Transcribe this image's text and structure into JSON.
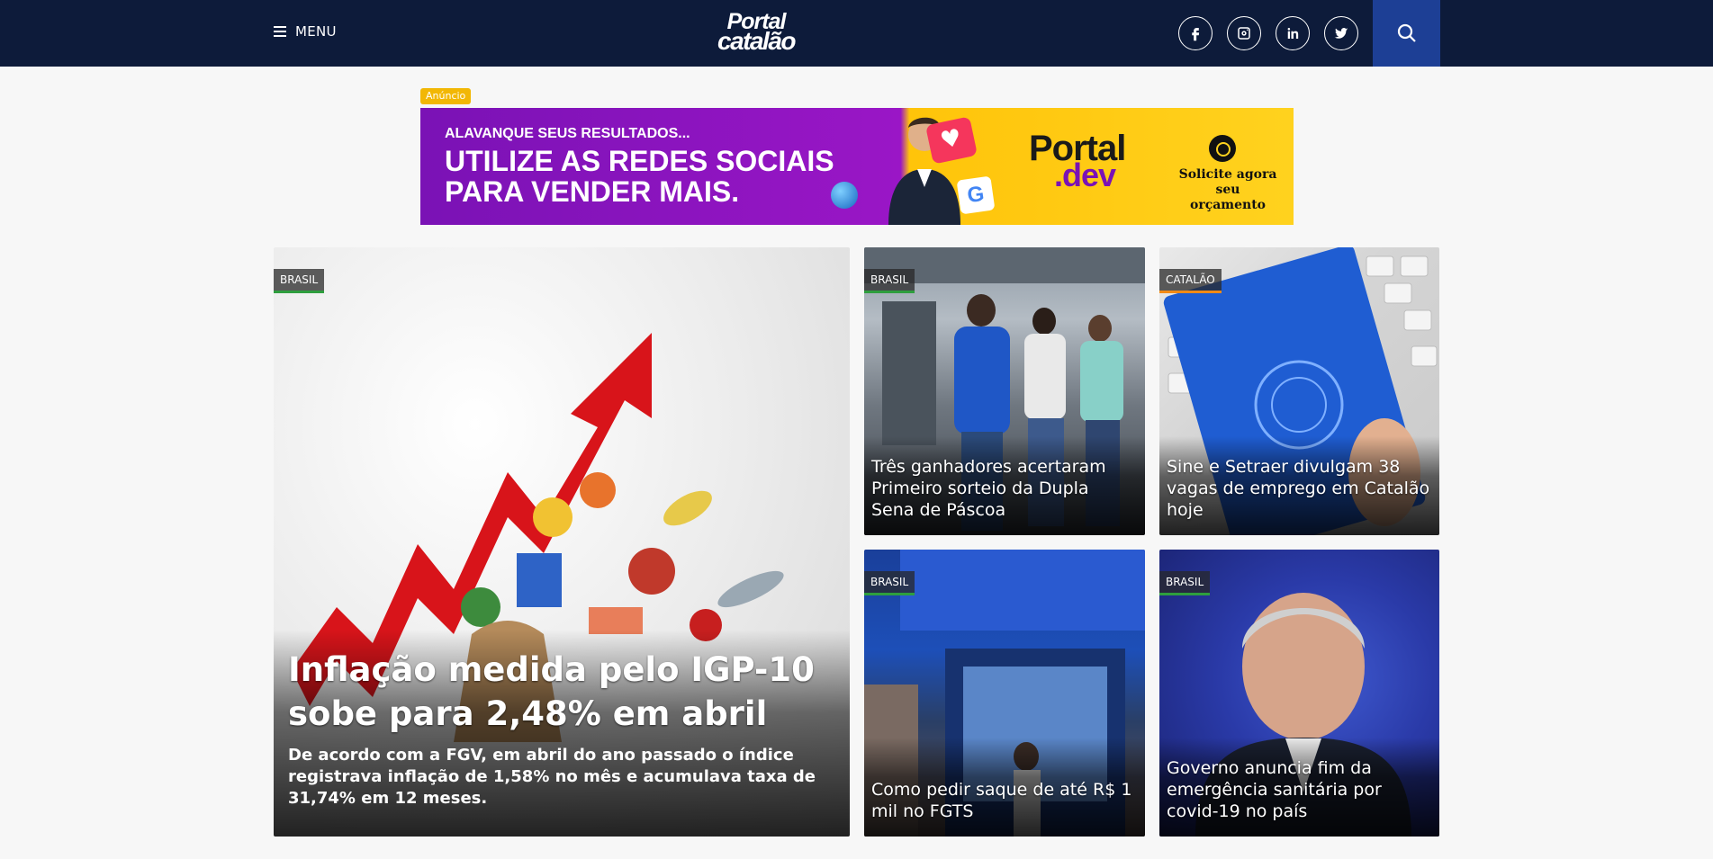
{
  "header": {
    "menu_label": "MENU",
    "logo_line1": "Portal",
    "logo_line2": "catalão",
    "social": [
      "facebook-icon",
      "instagram-icon",
      "linkedin-icon",
      "twitter-icon"
    ],
    "search_icon": "search-icon",
    "colors": {
      "bar": "#0d1b3a",
      "search": "#1d3f95"
    }
  },
  "ad": {
    "tag": "Anúncio",
    "pretitle": "ALAVANQUE SEUS RESULTADOS...",
    "headline": "UTILIZE AS REDES SOCIAIS PARA VENDER MAIS.",
    "brand_line1": "Portal",
    "brand_line2": ".dev",
    "cta": "Solicite agora seu orçamento",
    "colors": {
      "purple": "#7a12b5",
      "yellow": "#ffd21e"
    }
  },
  "news": {
    "featured": {
      "category": "BRASIL",
      "title": "Inflação medida pelo IGP-10 sobe para 2,48% em abril",
      "summary": "De acordo com a FGV, em abril do ano passado o índice registrava inflação de 1,58% no mês e acumulava taxa de 31,74% em 12 meses."
    },
    "items": [
      {
        "category": "BRASIL",
        "title": "Três ganhadores acertaram Primeiro sorteio da Dupla Sena de Páscoa"
      },
      {
        "category": "CATALÃO",
        "title": "Sine e Setraer divulgam 38 vagas de emprego em Catalão hoje"
      },
      {
        "category": "BRASIL",
        "title": "Como pedir saque de até R$ 1 mil no FGTS"
      },
      {
        "category": "BRASIL",
        "title": "Governo anuncia fim da emergência sanitária por covid-19 no país"
      }
    ],
    "tag_colors": {
      "brasil": "#2e9e3e",
      "catalao": "#f28a16"
    }
  }
}
